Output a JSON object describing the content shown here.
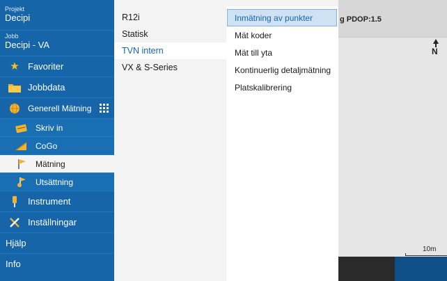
{
  "sidebar": {
    "project_label": "Projekt",
    "project_value": "Decipi",
    "job_label": "Jobb",
    "job_value": "Decipi - VA",
    "favorites": "Favoriter",
    "jobdata": "Jobbdata",
    "measure_general": "Generell Mätning",
    "sub_items": [
      "Skriv in",
      "CoGo",
      "Mätning",
      "Utsättning"
    ],
    "instrument": "Instrument",
    "settings": "Inställningar",
    "help": "Hjälp",
    "info": "Info"
  },
  "middle": {
    "items": [
      "R12i",
      "Statisk",
      "TVN intern",
      "VX & S-Series"
    ]
  },
  "submenu": {
    "items": [
      "Inmätning av punkter",
      "Mät koder",
      "Mät till yta",
      "Kontinuerlig detaljmätning",
      "Platskalibrering"
    ]
  },
  "map": {
    "status_text": "g PDOP:1.5",
    "north": "N",
    "scale": "10m"
  },
  "colors": {
    "sidebar_blue": "#1565a8",
    "selection_blue": "#cfe2f4",
    "star_yellow": "#f5c518"
  }
}
